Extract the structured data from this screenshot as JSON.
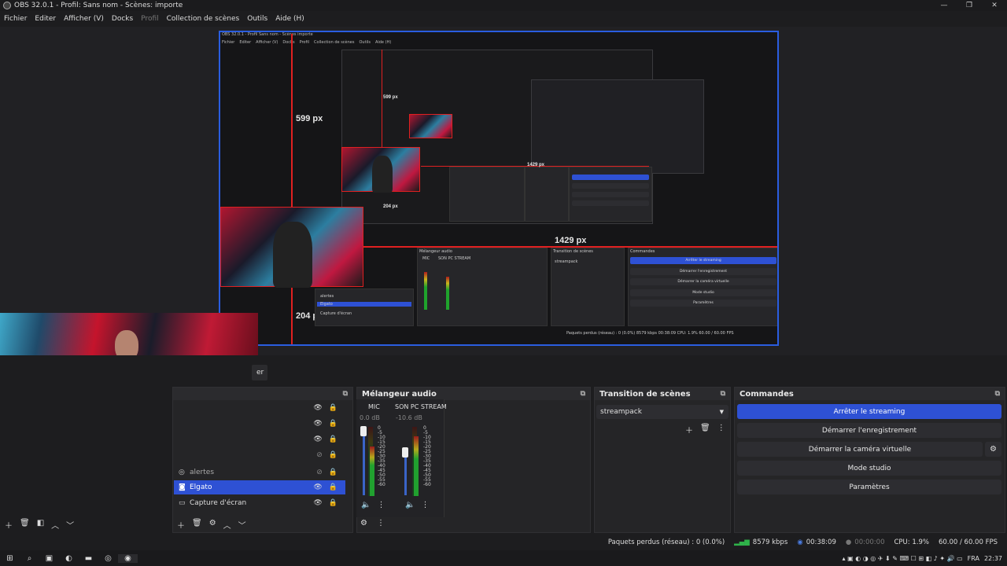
{
  "window": {
    "title": "OBS 32.0.1 - Profil: Sans nom - Scènes: importe",
    "controls": [
      "—",
      "❐",
      "✕"
    ]
  },
  "menu": [
    "Fichier",
    "Editer",
    "Afficher (V)",
    "Docks",
    "Profil",
    "Collection de scènes",
    "Outils",
    "Aide (H)"
  ],
  "preview": {
    "dim_599_a": "599 px",
    "dim_1429": "1429 px",
    "dim_204": "204 px",
    "dim_599_b": "599 px",
    "dim_1429_b": "1429 px",
    "dim_204_b": "204 px",
    "mini_title": "OBS 32.0.1 - Profil Sans nom - Scènes importe",
    "mini_menu": [
      "Fichier",
      "Editer",
      "Afficher (V)",
      "Docks",
      "Profil",
      "Collection de scènes",
      "Outils",
      "Aide (H)"
    ],
    "mini_mixer": "Mélangeur audio",
    "mini_transition": "Transition de scènes",
    "mini_commands": "Commandes",
    "mini_mic": "MIC",
    "mini_son": "SON PC STREAM",
    "mini_streampack": "streampack",
    "mini_cmds": [
      "Arrêter le streaming",
      "Démarrer l'enregistrement",
      "Démarrer la caméra virtuelle",
      "Mode studio",
      "Paramètres"
    ],
    "mini_sources": [
      "alertes",
      "Elgato",
      "Capture d'écran"
    ],
    "mini_status": "Paquets perdus (réseau) : 0 (0.0%)   8579 kbps   00:38:09   CPU: 1.9%   60.00 / 60.00 FPS"
  },
  "scenes_tab_partial": "er",
  "sources": {
    "items": [
      {
        "label": "alertes",
        "icon": "globe-icon",
        "visible": false
      },
      {
        "label": "Elgato",
        "icon": "camera-icon",
        "visible": true,
        "selected": true
      },
      {
        "label": "Capture d'écran",
        "icon": "monitor-icon",
        "visible": true
      }
    ]
  },
  "mixer": {
    "title": "Mélangeur audio",
    "channels": [
      {
        "name": "MIC",
        "db": "0.0 dB"
      },
      {
        "name": "SON PC STREAM",
        "db": "-10.6 dB"
      }
    ],
    "scale": [
      "0",
      "-5",
      "-10",
      "-15",
      "-20",
      "-25",
      "-30",
      "-35",
      "-40",
      "-45",
      "-50",
      "-55",
      "-60"
    ]
  },
  "transition": {
    "title": "Transition de scènes",
    "selected": "streampack"
  },
  "commands": {
    "title": "Commandes",
    "buttons": [
      "Arrêter le streaming",
      "Démarrer l'enregistrement",
      "Démarrer la caméra virtuelle",
      "Mode studio",
      "Paramètres"
    ]
  },
  "status": {
    "dropped": "Paquets perdus (réseau) : 0 (0.0%)",
    "bitrate": "8579 kbps",
    "stream_time": "00:38:09",
    "rec_time": "00:00:00",
    "cpu": "CPU: 1.9%",
    "fps": "60.00 / 60.00 FPS"
  },
  "taskbar": {
    "lang": "FRA",
    "time": "22:37"
  },
  "colors": {
    "accent": "#2e51d4",
    "guide_red": "#e02020",
    "bitrate_green": "#2fb34a"
  }
}
